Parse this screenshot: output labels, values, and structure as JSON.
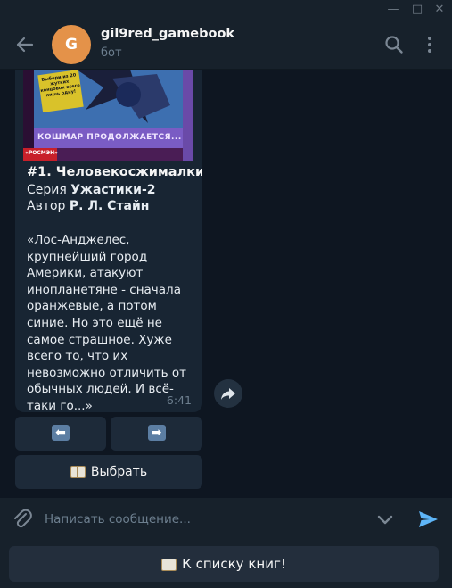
{
  "window": {
    "minimize": "—",
    "maximize": "□",
    "close": "✕"
  },
  "header": {
    "avatar_letter": "G",
    "chat_name": "gil9red_gamebook",
    "status": "бот",
    "avatar_color": "#e49249"
  },
  "message": {
    "cover_text_top": "Выбери из 20 жутких концовок всего лишь одну!",
    "cover_caption": "КОШМАР ПРОДОЛЖАЕТСЯ...",
    "cover_publisher": "«РОСМЭН»",
    "title": "#1. Человекосжималки",
    "series_prefix": "Серия ",
    "series": "Ужастики-2",
    "author_prefix": "Автор ",
    "author": "Р. Л. Стайн",
    "description": "«Лос-Анджелес, крупнейший город Америки, атакуют инопланетяне - сначала оранжевые, а потом синие. Но это ещё не самое страшное. Хуже всего то, что их невозможно отличить от обычных людей. И всё-таки го...»",
    "time": "6:41"
  },
  "inline_keyboard": {
    "prev": "⬅",
    "next": "➡",
    "select": "Выбрать"
  },
  "input": {
    "placeholder": "Написать сообщение...",
    "value": ""
  },
  "reply_keyboard": {
    "button": "К списку книг!"
  },
  "colors": {
    "background": "#0e1621",
    "panel": "#17212b",
    "bubble": "#182533",
    "accent": "#5eb5f7"
  }
}
